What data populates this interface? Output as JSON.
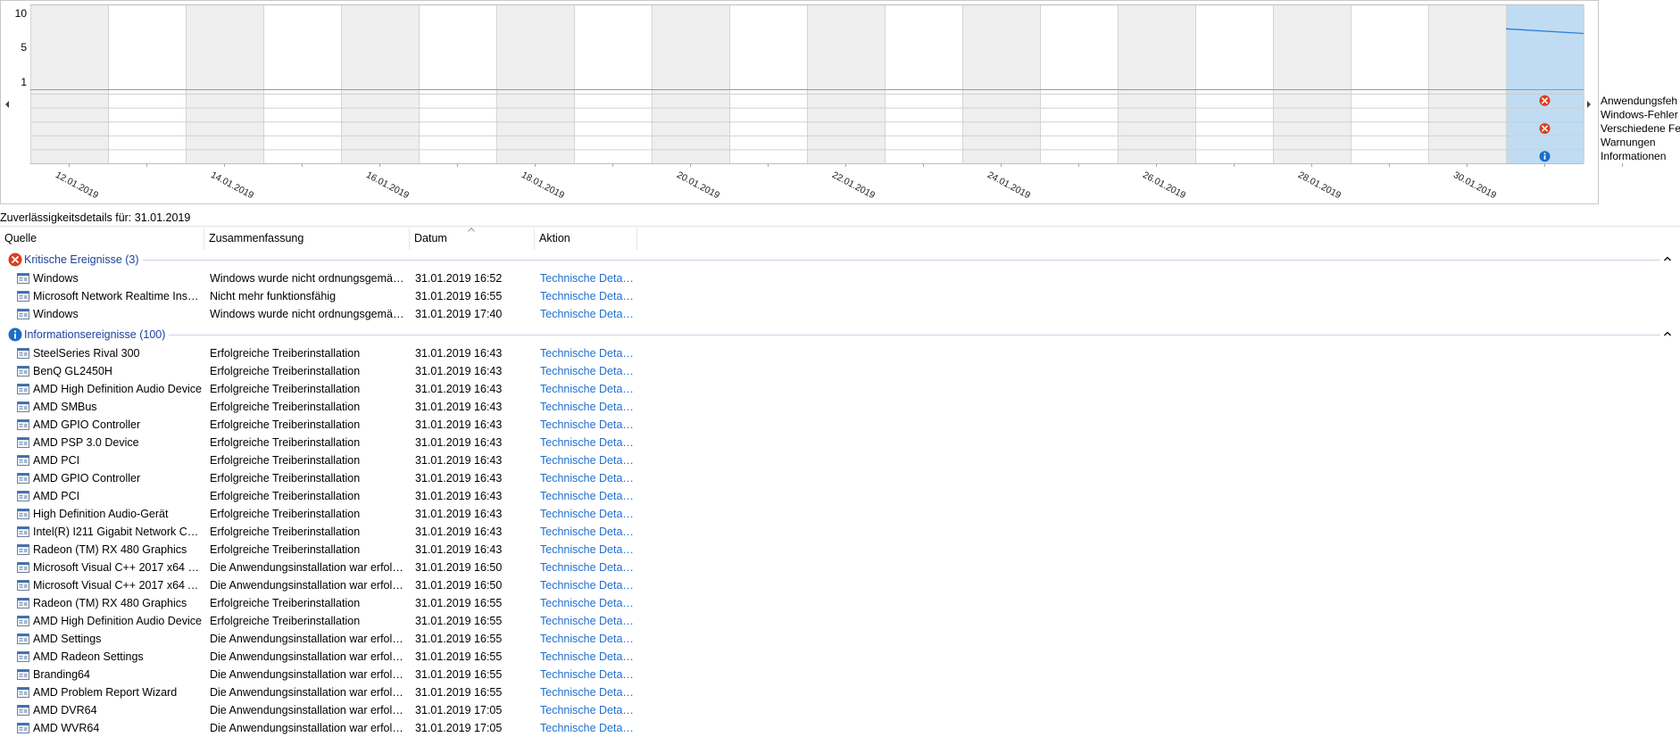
{
  "chart": {
    "y_ticks": [
      "10",
      "5",
      "1"
    ],
    "legend": [
      "Anwendungsfeh",
      "Windows-Fehler",
      "Verschiedene Feh",
      "Warnungen",
      "Informationen"
    ],
    "dates": [
      "12.01.2019",
      "14.01.2019",
      "16.01.2019",
      "18.01.2019",
      "20.01.2019",
      "22.01.2019",
      "24.01.2019",
      "26.01.2019",
      "28.01.2019",
      "30.01.2019"
    ],
    "selected_column": 19,
    "column_count": 20,
    "index_line": [
      {
        "column": 19,
        "start": 8.0,
        "end": 7.4
      }
    ],
    "markers": [
      {
        "column": 19,
        "row": "Anwendungsfeh",
        "icon": "error-icon"
      },
      {
        "column": 19,
        "row": "Verschiedene Feh",
        "icon": "error-icon"
      },
      {
        "column": 19,
        "row": "Informationen",
        "icon": "info-icon"
      }
    ],
    "colors": {
      "selected": "#bfdcf3",
      "alt_column": "#efefef",
      "line": "#2f7fd4",
      "error": "#dc3d1f",
      "info": "#1a6ec8"
    }
  },
  "details_title": "Zuverlässigkeitsdetails für: 31.01.2019",
  "columns": [
    "Quelle",
    "Zusammenfassung",
    "Datum",
    "Aktion"
  ],
  "groups": [
    {
      "label": "Kritische Ereignisse (3)",
      "icon": "error-icon",
      "rows": [
        {
          "source": "Windows",
          "summary": "Windows wurde nicht ordnungsgemäß ...",
          "date": "31.01.2019 16:52",
          "action": "Technische Detail..."
        },
        {
          "source": "Microsoft Network Realtime Inspe...",
          "summary": "Nicht mehr funktionsfähig",
          "date": "31.01.2019 16:55",
          "action": "Technische Detail..."
        },
        {
          "source": "Windows",
          "summary": "Windows wurde nicht ordnungsgemäß ...",
          "date": "31.01.2019 17:40",
          "action": "Technische Detail..."
        }
      ]
    },
    {
      "label": "Informationsereignisse (100)",
      "icon": "info-icon",
      "rows": [
        {
          "source": "SteelSeries Rival 300",
          "summary": "Erfolgreiche Treiberinstallation",
          "date": "31.01.2019 16:43",
          "action": "Technische Detail..."
        },
        {
          "source": "BenQ GL2450H",
          "summary": "Erfolgreiche Treiberinstallation",
          "date": "31.01.2019 16:43",
          "action": "Technische Detail..."
        },
        {
          "source": "AMD High Definition Audio Device",
          "summary": "Erfolgreiche Treiberinstallation",
          "date": "31.01.2019 16:43",
          "action": "Technische Detail..."
        },
        {
          "source": "AMD SMBus",
          "summary": "Erfolgreiche Treiberinstallation",
          "date": "31.01.2019 16:43",
          "action": "Technische Detail..."
        },
        {
          "source": "AMD GPIO Controller",
          "summary": "Erfolgreiche Treiberinstallation",
          "date": "31.01.2019 16:43",
          "action": "Technische Detail..."
        },
        {
          "source": "AMD PSP 3.0 Device",
          "summary": "Erfolgreiche Treiberinstallation",
          "date": "31.01.2019 16:43",
          "action": "Technische Detail..."
        },
        {
          "source": "AMD PCI",
          "summary": "Erfolgreiche Treiberinstallation",
          "date": "31.01.2019 16:43",
          "action": "Technische Detail..."
        },
        {
          "source": "AMD GPIO Controller",
          "summary": "Erfolgreiche Treiberinstallation",
          "date": "31.01.2019 16:43",
          "action": "Technische Detail..."
        },
        {
          "source": "AMD PCI",
          "summary": "Erfolgreiche Treiberinstallation",
          "date": "31.01.2019 16:43",
          "action": "Technische Detail..."
        },
        {
          "source": "High Definition Audio-Gerät",
          "summary": "Erfolgreiche Treiberinstallation",
          "date": "31.01.2019 16:43",
          "action": "Technische Detail..."
        },
        {
          "source": "Intel(R) I211 Gigabit Network Con...",
          "summary": "Erfolgreiche Treiberinstallation",
          "date": "31.01.2019 16:43",
          "action": "Technische Detail..."
        },
        {
          "source": "Radeon (TM) RX 480 Graphics",
          "summary": "Erfolgreiche Treiberinstallation",
          "date": "31.01.2019 16:43",
          "action": "Technische Detail..."
        },
        {
          "source": "Microsoft Visual C++ 2017 x64 Mi...",
          "summary": "Die Anwendungsinstallation war erfolgr...",
          "date": "31.01.2019 16:50",
          "action": "Technische Detail..."
        },
        {
          "source": "Microsoft Visual C++ 2017 x64 Ad...",
          "summary": "Die Anwendungsinstallation war erfolgr...",
          "date": "31.01.2019 16:50",
          "action": "Technische Detail..."
        },
        {
          "source": "Radeon (TM) RX 480 Graphics",
          "summary": "Erfolgreiche Treiberinstallation",
          "date": "31.01.2019 16:55",
          "action": "Technische Detail..."
        },
        {
          "source": "AMD High Definition Audio Device",
          "summary": "Erfolgreiche Treiberinstallation",
          "date": "31.01.2019 16:55",
          "action": "Technische Detail..."
        },
        {
          "source": "AMD Settings",
          "summary": "Die Anwendungsinstallation war erfolgr...",
          "date": "31.01.2019 16:55",
          "action": "Technische Detail..."
        },
        {
          "source": "AMD Radeon Settings",
          "summary": "Die Anwendungsinstallation war erfolgr...",
          "date": "31.01.2019 16:55",
          "action": "Technische Detail..."
        },
        {
          "source": "Branding64",
          "summary": "Die Anwendungsinstallation war erfolgr...",
          "date": "31.01.2019 16:55",
          "action": "Technische Detail..."
        },
        {
          "source": "AMD Problem Report Wizard",
          "summary": "Die Anwendungsinstallation war erfolgr...",
          "date": "31.01.2019 16:55",
          "action": "Technische Detail..."
        },
        {
          "source": "AMD DVR64",
          "summary": "Die Anwendungsinstallation war erfolgr...",
          "date": "31.01.2019 17:05",
          "action": "Technische Detail..."
        },
        {
          "source": "AMD WVR64",
          "summary": "Die Anwendungsinstallation war erfolgr...",
          "date": "31.01.2019 17:05",
          "action": "Technische Detail..."
        }
      ]
    }
  ]
}
